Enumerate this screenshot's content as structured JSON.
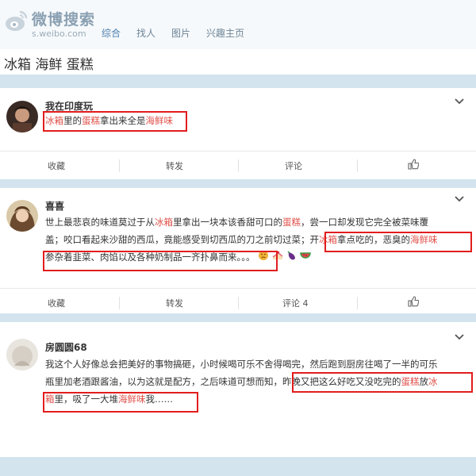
{
  "header": {
    "logo_text": "微博搜索",
    "logo_sub": "s.weibo.com",
    "nav": [
      {
        "label": "综合",
        "active": true
      },
      {
        "label": "找人",
        "active": false
      },
      {
        "label": "图片",
        "active": false
      },
      {
        "label": "兴趣主页",
        "active": false
      }
    ]
  },
  "search": {
    "query": "冰箱 海鲜 蛋糕"
  },
  "colors": {
    "highlight": "#e0504a",
    "annotation_box": "#e21d1d",
    "page_bg": "#d3e4ef"
  },
  "posts": [
    {
      "username": "我在印度玩",
      "lines": [
        [
          {
            "t": "冰箱",
            "h": true
          },
          {
            "t": "里的",
            "h": false
          },
          {
            "t": "蛋糕",
            "h": true
          },
          {
            "t": "拿出来全是",
            "h": false
          },
          {
            "t": "海鲜味",
            "h": true
          }
        ]
      ],
      "actions": {
        "fav": "收藏",
        "repost": "转发",
        "comment": "评论"
      }
    },
    {
      "username": "喜喜",
      "lines": [
        [
          {
            "t": "世上最悲哀的味道莫过于从",
            "h": false
          },
          {
            "t": "冰箱",
            "h": true
          },
          {
            "t": "里拿出一块本该香甜可口的",
            "h": false
          },
          {
            "t": "蛋糕",
            "h": true
          },
          {
            "t": "，尝一口却发现它完全被菜味覆",
            "h": false
          }
        ],
        [
          {
            "t": "盖；咬口看起来沙甜的西瓜，竟能感受到切西瓜的刀之前切过菜；开",
            "h": false
          },
          {
            "t": "冰箱",
            "h": true
          },
          {
            "t": "拿点吃的，恶臭的",
            "h": false
          },
          {
            "t": "海鲜味",
            "h": true
          }
        ],
        [
          {
            "t": "参杂着韭菜、肉馅以及各种奶制品一齐扑鼻而来。。。",
            "h": false
          }
        ]
      ],
      "actions": {
        "fav": "收藏",
        "repost": "转发",
        "comment": "评论 4"
      }
    },
    {
      "username": "房圆圆68",
      "lines": [
        [
          {
            "t": "我这个人好像总会把美好的事物搞砸，小时候喝可乐不舍得喝完，然后跑到厨房往喝了一半的可乐",
            "h": false
          }
        ],
        [
          {
            "t": "瓶里加老酒跟酱油，以为这就是配方，之后味道可想而知，昨晚又把这么好吃又没吃完的",
            "h": false
          },
          {
            "t": "蛋糕",
            "h": true
          },
          {
            "t": "放",
            "h": false
          },
          {
            "t": "冰",
            "h": true
          }
        ],
        [
          {
            "t": "箱",
            "h": true
          },
          {
            "t": "里，吸了一大堆",
            "h": false
          },
          {
            "t": "海鲜味",
            "h": true
          },
          {
            "t": "我……",
            "h": false
          }
        ]
      ]
    }
  ]
}
